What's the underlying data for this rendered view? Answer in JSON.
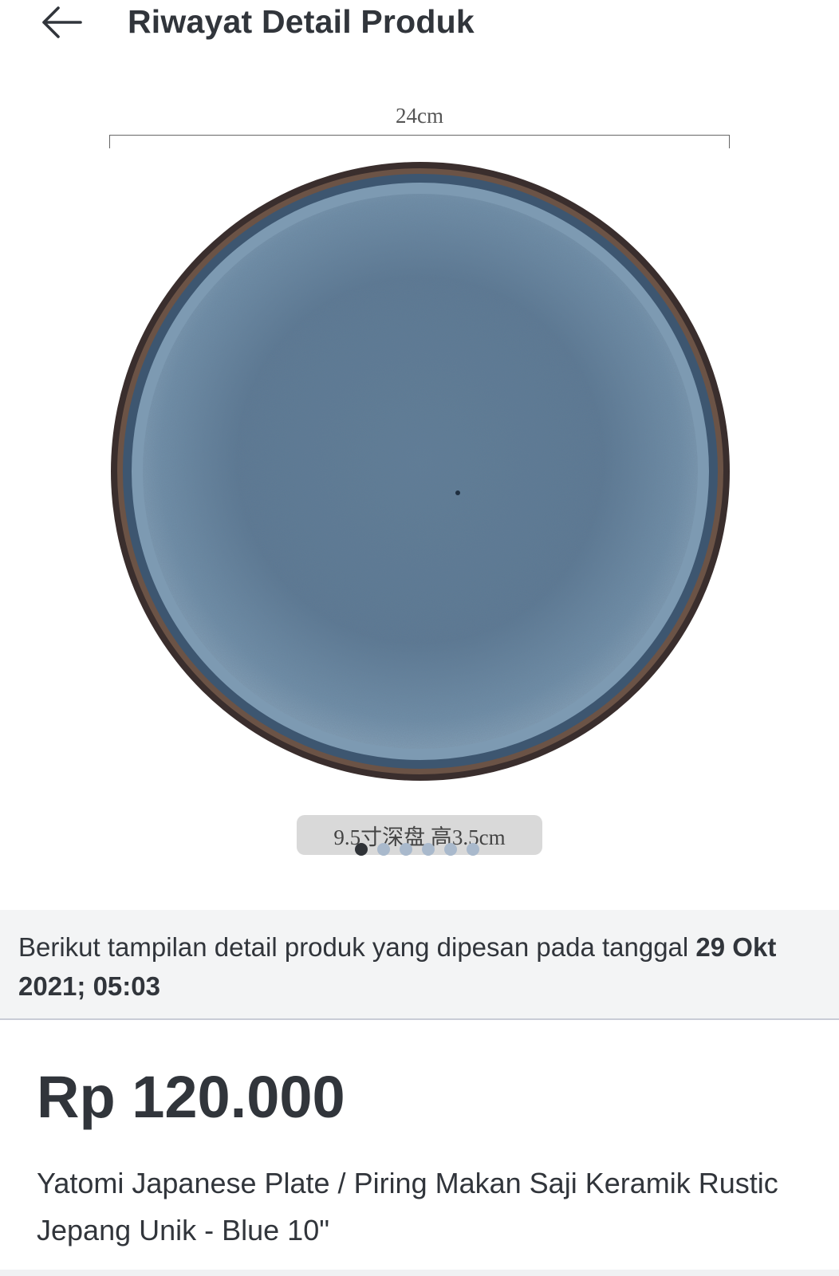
{
  "header": {
    "title": "Riwayat Detail Produk",
    "back_icon": "arrow-left-icon"
  },
  "gallery": {
    "dimension_label": "24cm",
    "caption": "9.5寸深盘 高3.5cm",
    "image_count": 6,
    "active_index": 1
  },
  "info": {
    "text": "Berikut tampilan detail produk yang dipesan pada tanggal ",
    "date": "29 Okt 2021; 05:03"
  },
  "product": {
    "price": "Rp 120.000",
    "name": "Yatomi Japanese Plate / Piring Makan Saji Keramik Rustic Jepang Unik - Blue 10\""
  },
  "colors": {
    "text": "#31353b",
    "band": "#f3f4f5",
    "plate": "#5b7a95"
  }
}
